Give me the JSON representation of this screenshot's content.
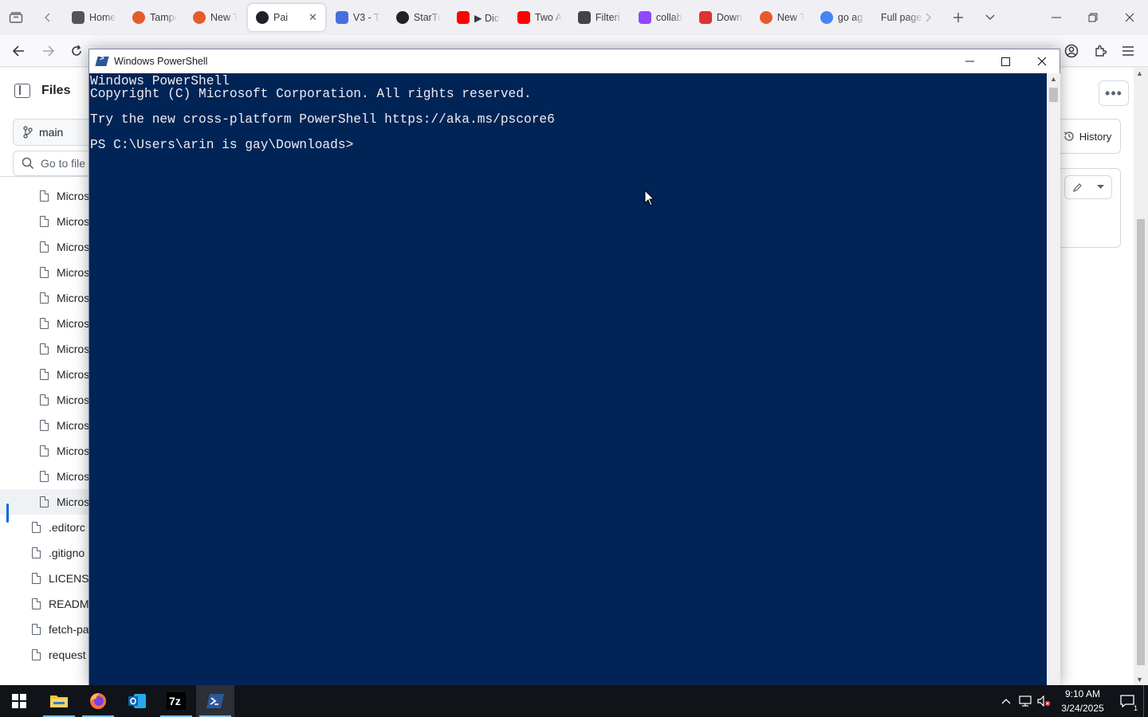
{
  "browser": {
    "tabs": [
      {
        "label": "Home",
        "icon": "robot-favicon-icon",
        "color": "#555"
      },
      {
        "label": "Tampermonkey",
        "icon": "firefox-favicon-icon",
        "color": "#e55b2d"
      },
      {
        "label": "New Tab",
        "icon": "firefox-favicon-icon",
        "color": "#e55b2d"
      },
      {
        "label": "Pai",
        "icon": "github-favicon-icon",
        "color": "#1f2328",
        "active": true
      },
      {
        "label": "V3 - T",
        "icon": "google-docs-favicon-icon",
        "color": "#4a6ee0"
      },
      {
        "label": "StarTu",
        "icon": "star-favicon-icon",
        "color": "#222"
      },
      {
        "label": "▶ Dic",
        "icon": "youtube-favicon-icon",
        "color": "#ff0000"
      },
      {
        "label": "Two A",
        "icon": "youtube-favicon-icon",
        "color": "#ff0000"
      },
      {
        "label": "Filteri",
        "icon": "list-favicon-icon",
        "color": "#444"
      },
      {
        "label": "collab",
        "icon": "twitch-favicon-icon",
        "color": "#9146ff"
      },
      {
        "label": "Down",
        "icon": "sixtyfour-favicon-icon",
        "color": "#d33"
      },
      {
        "label": "New T",
        "icon": "firefox-favicon-icon",
        "color": "#e55b2d"
      },
      {
        "label": "go ag",
        "icon": "google-favicon-icon",
        "color": "#4285f4"
      },
      {
        "label": "Full page",
        "icon": "none",
        "color": "#fff"
      }
    ]
  },
  "github": {
    "files_title": "Files",
    "branch": "main",
    "goto_placeholder": "Go to file",
    "history_label": "History",
    "tree": [
      {
        "name": "Micros",
        "nested": true
      },
      {
        "name": "Micros",
        "nested": true
      },
      {
        "name": "Micros",
        "nested": true
      },
      {
        "name": "Micros",
        "nested": true
      },
      {
        "name": "Micros",
        "nested": true
      },
      {
        "name": "Micros",
        "nested": true
      },
      {
        "name": "Micros",
        "nested": true
      },
      {
        "name": "Micros",
        "nested": true
      },
      {
        "name": "Micros",
        "nested": true
      },
      {
        "name": "Micros",
        "nested": true
      },
      {
        "name": "Micros",
        "nested": true
      },
      {
        "name": "Micros",
        "nested": true
      },
      {
        "name": "Micros",
        "nested": true,
        "selected": true
      },
      {
        "name": ".editorc",
        "nested": false
      },
      {
        "name": ".gitigno",
        "nested": false
      },
      {
        "name": "LICENSE",
        "nested": false
      },
      {
        "name": "READM",
        "nested": false
      },
      {
        "name": "fetch-pa",
        "nested": false
      },
      {
        "name": "request",
        "nested": false
      }
    ]
  },
  "powershell": {
    "title": "Windows PowerShell",
    "lines": [
      "Windows PowerShell",
      "Copyright (C) Microsoft Corporation. All rights reserved.",
      "",
      "Try the new cross-platform PowerShell https://aka.ms/pscore6",
      "",
      "PS C:\\Users\\arin is gay\\Downloads>"
    ],
    "bg_color": "#012456"
  },
  "taskbar": {
    "time": "9:10 AM",
    "date": "3/24/2025",
    "notification_count": "1"
  }
}
